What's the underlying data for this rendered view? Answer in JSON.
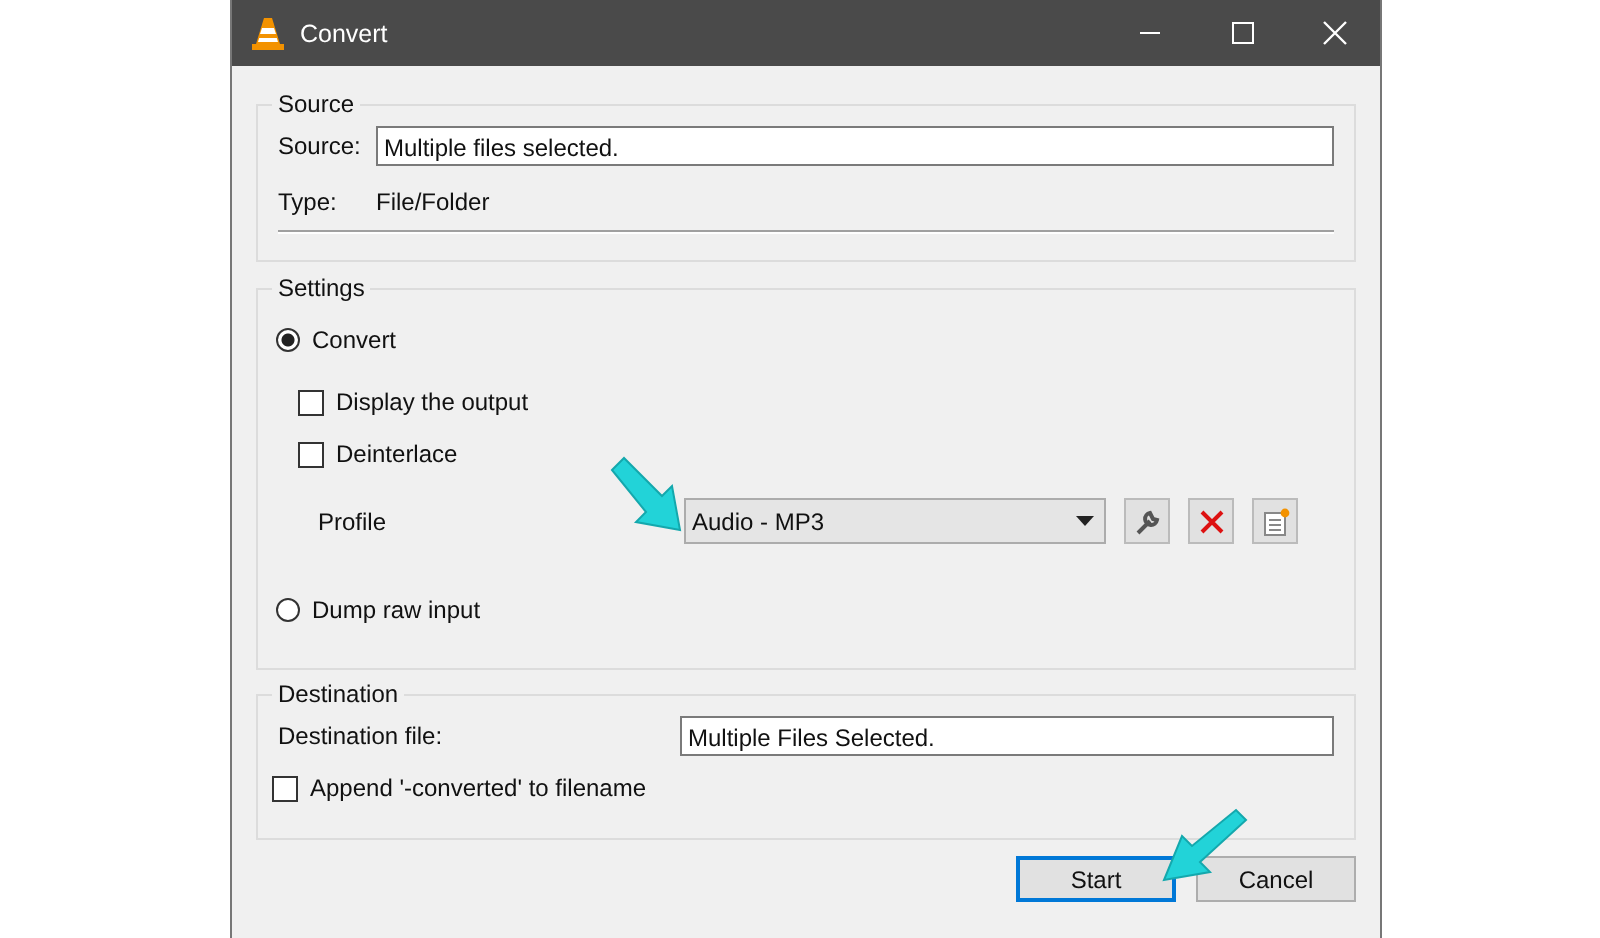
{
  "window": {
    "title": "Convert"
  },
  "source_group": {
    "title": "Source",
    "source_label": "Source:",
    "source_value": "Multiple files selected.",
    "type_label": "Type:",
    "type_value": "File/Folder"
  },
  "settings_group": {
    "title": "Settings",
    "modes": [
      {
        "label": "Convert",
        "selected": true
      },
      {
        "label": "Dump raw input",
        "selected": false
      }
    ],
    "options": [
      {
        "label": "Display the output",
        "checked": false
      },
      {
        "label": "Deinterlace",
        "checked": false
      }
    ],
    "profile_label": "Profile",
    "profile_value": "Audio - MP3"
  },
  "destination_group": {
    "title": "Destination",
    "file_label": "Destination file:",
    "file_value": "Multiple Files Selected.",
    "append": {
      "label": "Append '-converted' to filename",
      "checked": false
    }
  },
  "buttons": [
    {
      "label": "Start",
      "default": true
    },
    {
      "label": "Cancel",
      "default": false
    }
  ]
}
